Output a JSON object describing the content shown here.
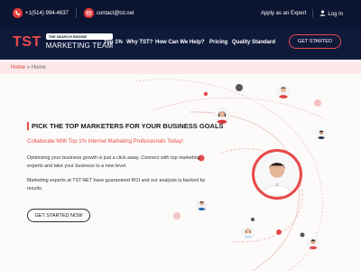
{
  "topbar": {
    "phone": "+1(514) 994-4637",
    "email": "contact@tst.net",
    "apply_expert": "Apply as an Expert",
    "login": "Log In",
    "phone_icon": "phone-icon",
    "email_icon": "email-icon",
    "user_icon": "user-icon"
  },
  "logo": {
    "brand": "TST",
    "tagline": "THE SEARCH ENGINE",
    "name": "MARKETING TEAM"
  },
  "nav": {
    "items": [
      "Top 1%",
      "Why TST?",
      "How Can We Help?",
      "Pricing",
      "Quality Standard"
    ],
    "cta": "GET STARTED"
  },
  "breadcrumb": {
    "home": "Home",
    "separator": "»",
    "current": "Home"
  },
  "hero": {
    "title": "PICK THE TOP MARKETERS FOR YOUR BUSINESS GOALS",
    "subtitle": "Collaborate With Top 1% Internet Marketing Professionals Today!",
    "para1": "Optimizing your business growth is just a click away. Connect with top marketing experts and take your business to a new level.",
    "para2": "Marketing experts at TST.NET have guaranteed ROI and our analysis is backed by results.",
    "cta": "GET STARTED NOW"
  },
  "colors": {
    "accent": "#e84a4a",
    "navy": "#0f1a3b",
    "topbar": "#0b1430",
    "crumb_bg": "#fde9e9"
  }
}
